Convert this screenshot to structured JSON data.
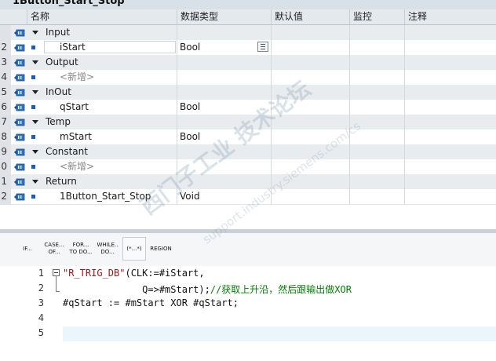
{
  "block_title": "1Button_Start_Stop",
  "columns": [
    "名称",
    "数据类型",
    "默认值",
    "监控",
    "注释"
  ],
  "rows": [
    {
      "num": "",
      "kind": "section",
      "name": "Input",
      "type": ""
    },
    {
      "num": "2",
      "kind": "item",
      "name": "iStart",
      "type": "Bool",
      "selected": true
    },
    {
      "num": "3",
      "kind": "section",
      "name": "Output",
      "type": ""
    },
    {
      "num": "4",
      "kind": "item",
      "name": "<新增>",
      "type": "",
      "placeholder": true
    },
    {
      "num": "5",
      "kind": "section",
      "name": "InOut",
      "type": ""
    },
    {
      "num": "6",
      "kind": "item",
      "name": "qStart",
      "type": "Bool"
    },
    {
      "num": "7",
      "kind": "section",
      "name": "Temp",
      "type": ""
    },
    {
      "num": "8",
      "kind": "item",
      "name": "mStart",
      "type": "Bool"
    },
    {
      "num": "9",
      "kind": "section",
      "name": "Constant",
      "type": ""
    },
    {
      "num": "0",
      "kind": "item",
      "name": "<新增>",
      "type": "",
      "placeholder": true
    },
    {
      "num": "1",
      "kind": "section",
      "name": "Return",
      "type": ""
    },
    {
      "num": "2",
      "kind": "item",
      "name": "1Button_Start_Stop",
      "type": "Void"
    }
  ],
  "toolbar": {
    "if": "IF...",
    "case": [
      "CASE...",
      "OF..."
    ],
    "for": [
      "FOR...",
      "TO DO..."
    ],
    "while": [
      "WHILE..",
      "DO..."
    ],
    "comment": "(*...*)",
    "region": "REGION"
  },
  "code": {
    "line_numbers": [
      "1",
      "2",
      "3",
      "4",
      "5"
    ],
    "line1": {
      "fb": "\"R_TRIG_DB\"",
      "rest": "(CLK:=#iStart,"
    },
    "line2": {
      "code": "Q=>#mStart);",
      "comment": "//获取上升沿，然后跟输出做XOR"
    },
    "line3": "#qStart := #mStart XOR #qStart;"
  },
  "watermark": {
    "main": "西门子工业  技术论坛",
    "sub": "support.industry.siemens.com/cs"
  },
  "colors": {
    "header_bg": "#e4e9ee",
    "section_bg": "#e9ecef",
    "accent_blue": "#1a5fb4",
    "comment_green": "#008000",
    "highlight": "#eaf6fb"
  }
}
